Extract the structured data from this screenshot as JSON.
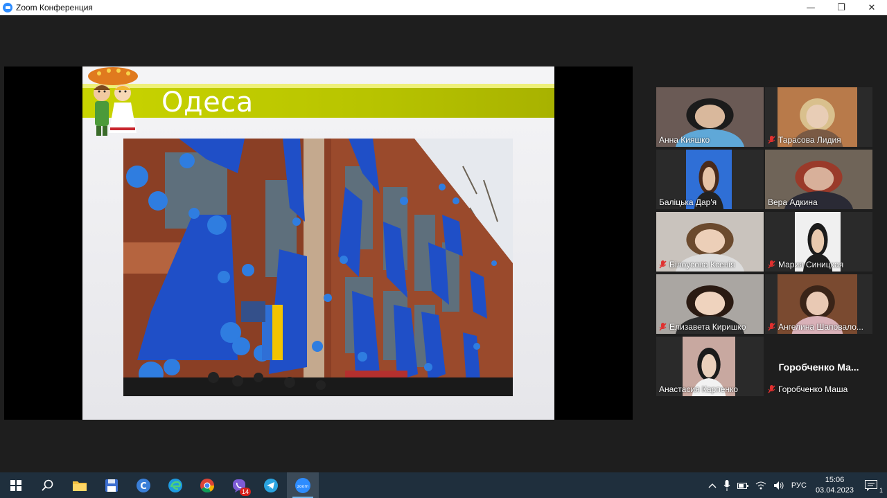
{
  "window": {
    "title": "Zoom Конференция",
    "minimize": "—",
    "restore": "❐",
    "close": "✕"
  },
  "slide": {
    "title": "Одеса"
  },
  "participants": [
    {
      "name": "Анна Кияшко",
      "muted": false,
      "active": true
    },
    {
      "name": "Тарасова Лидия",
      "muted": true,
      "active": false
    },
    {
      "name": "Баліцька Дар'я",
      "muted": false,
      "active": false
    },
    {
      "name": "Вера Адкина",
      "muted": false,
      "active": false
    },
    {
      "name": "Білоусова Ксенія",
      "muted": true,
      "active": false
    },
    {
      "name": "Мария Синицкая",
      "muted": true,
      "active": false
    },
    {
      "name": "Елизавета Киришко",
      "muted": true,
      "active": false
    },
    {
      "name": "Ангелина Шаповало...",
      "muted": true,
      "active": false
    },
    {
      "name": "Анастасия Карпенко",
      "muted": false,
      "active": false
    },
    {
      "name": "Горобченко Маша",
      "muted": true,
      "active": false,
      "center_label": "Горобченко Ма..."
    }
  ],
  "taskbar": {
    "apps": [
      "start-icon",
      "search-icon",
      "file-explorer-icon",
      "save-icon",
      "ccleaner-icon",
      "edge-icon",
      "chrome-icon",
      "viber-icon",
      "telegram-icon",
      "zoom-icon"
    ],
    "viber_badge": "14",
    "zoom_label": "zoom",
    "language": "РУС",
    "time": "15:06",
    "date": "03.04.2023",
    "notification_count": "1"
  },
  "colors": {
    "accent_border": "#c9e15f",
    "slide_band": "#c9d400",
    "taskbar_bg": "#1f2f3d"
  }
}
